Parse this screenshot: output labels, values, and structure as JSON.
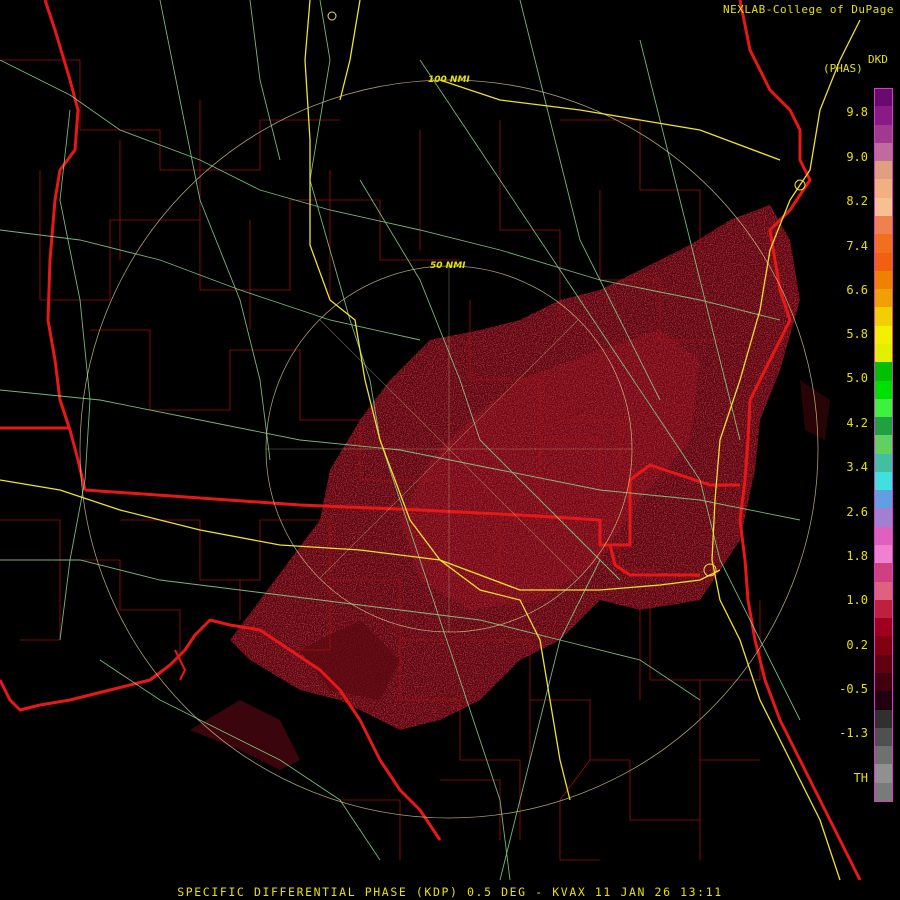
{
  "credit": "NEXLAB-College of DuPage",
  "product_units_top": "DKD",
  "product_units_bottom": "(PHAS)",
  "caption": "SPECIFIC DIFFERENTIAL PHASE (KDP) 0.5 DEG - KVAX 11 JAN 26 13:11",
  "range_rings": [
    {
      "label": "50 NMI"
    },
    {
      "label": "100 NMI"
    }
  ],
  "color_scale": {
    "ticks": [
      "9.8",
      "9.0",
      "8.2",
      "7.4",
      "6.6",
      "5.8",
      "5.0",
      "4.2",
      "3.4",
      "2.6",
      "1.8",
      "1.0",
      "0.2",
      "-0.5",
      "-1.3",
      "TH"
    ],
    "colors": [
      "#6a0a70",
      "#8a1a85",
      "#a03a90",
      "#c06aa0",
      "#e0a080",
      "#f0b080",
      "#f6c090",
      "#f08050",
      "#f07020",
      "#f06010",
      "#f08000",
      "#f0a000",
      "#f0d000",
      "#f0f000",
      "#e0f000",
      "#00c000",
      "#00e000",
      "#40f040",
      "#20a040",
      "#60d060",
      "#40c0a0",
      "#40e0e0",
      "#60a0e0",
      "#a080d0",
      "#e060c0",
      "#f080d0",
      "#d04080",
      "#e06080",
      "#c02040",
      "#a00020",
      "#800010",
      "#600010",
      "#400010",
      "#200010",
      "#303030",
      "#505050",
      "#707070",
      "#909090",
      "#7a7a7a"
    ]
  }
}
